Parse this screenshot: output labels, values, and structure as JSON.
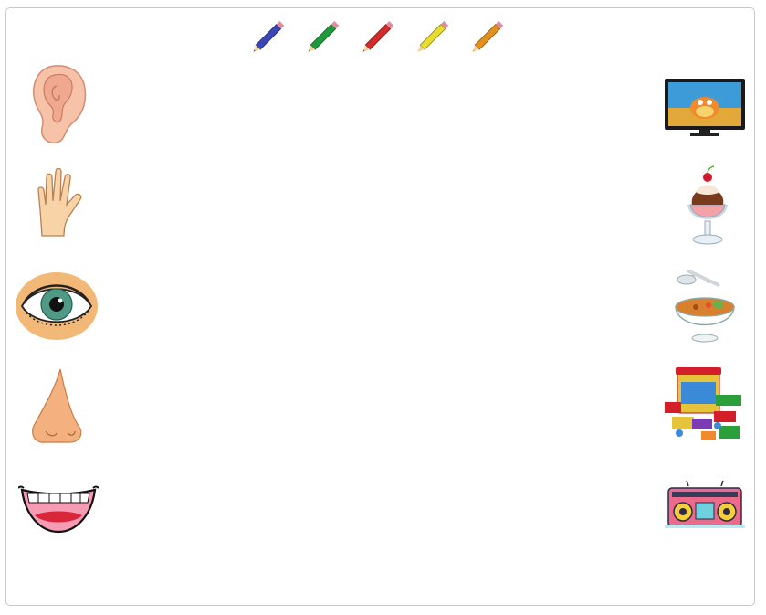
{
  "toolbar": {
    "pencils": [
      {
        "name": "blue-pencil",
        "color": "#3a46b4"
      },
      {
        "name": "green-pencil",
        "color": "#1f9a3a"
      },
      {
        "name": "red-pencil",
        "color": "#d12b2b"
      },
      {
        "name": "yellow-pencil",
        "color": "#e8dc2c"
      },
      {
        "name": "orange-pencil",
        "color": "#e3901c"
      }
    ]
  },
  "senses": [
    {
      "name": "ear",
      "icon": "ear-icon"
    },
    {
      "name": "hand",
      "icon": "hand-icon"
    },
    {
      "name": "eye",
      "icon": "eye-icon"
    },
    {
      "name": "nose",
      "icon": "nose-icon"
    },
    {
      "name": "mouth",
      "icon": "mouth-icon"
    }
  ],
  "objects": [
    {
      "name": "television",
      "icon": "television-icon"
    },
    {
      "name": "ice-cream",
      "icon": "ice-cream-icon"
    },
    {
      "name": "soup",
      "icon": "soup-icon"
    },
    {
      "name": "toy-blocks",
      "icon": "toy-blocks-icon"
    },
    {
      "name": "radio",
      "icon": "radio-icon"
    }
  ]
}
